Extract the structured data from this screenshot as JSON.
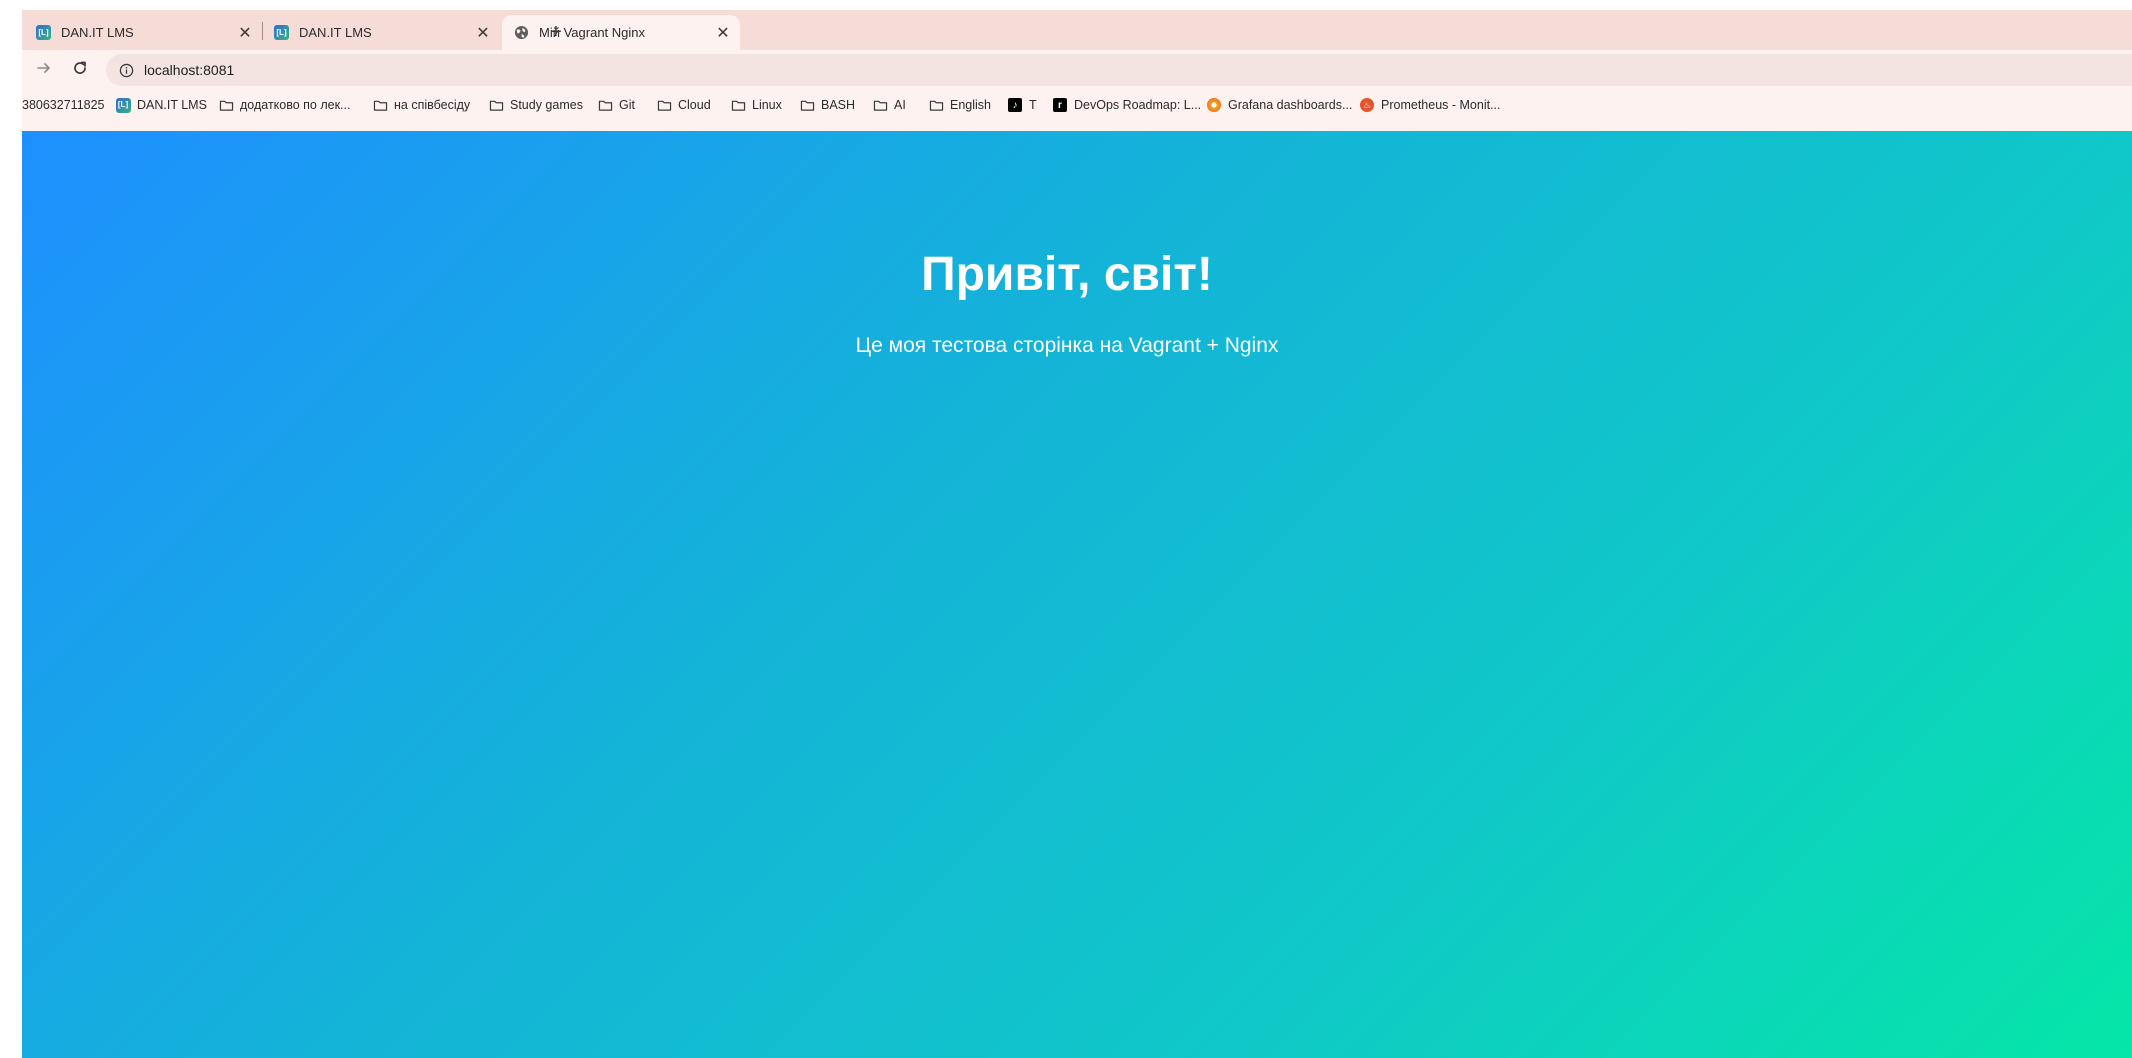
{
  "browser": {
    "tabs": [
      {
        "title": "DAN.IT LMS",
        "icon": "lms-favicon",
        "active": false
      },
      {
        "title": "DAN.IT LMS",
        "icon": "lms-favicon",
        "active": false
      },
      {
        "title": "Мій Vagrant Nginx",
        "icon": "globe-icon",
        "active": true
      }
    ],
    "tab_close_glyph": "✕",
    "new_tab_glyph": "+",
    "address_bar": {
      "url": "localhost:8081"
    },
    "bookmarks": [
      {
        "label": "380632711825",
        "icon": ""
      },
      {
        "label": "DAN.IT LMS",
        "icon": "lms-favicon"
      },
      {
        "label": "додатково по лек...",
        "icon": "folder-icon"
      },
      {
        "label": "на співбесіду",
        "icon": "folder-icon"
      },
      {
        "label": "Study games",
        "icon": "folder-icon"
      },
      {
        "label": "Git",
        "icon": "folder-icon"
      },
      {
        "label": "Cloud",
        "icon": "folder-icon"
      },
      {
        "label": "Linux",
        "icon": "folder-icon"
      },
      {
        "label": "BASH",
        "icon": "folder-icon"
      },
      {
        "label": "AI",
        "icon": "folder-icon"
      },
      {
        "label": "English",
        "icon": "folder-icon"
      },
      {
        "label": "T",
        "icon": "tiktok-icon"
      },
      {
        "label": "DevOps Roadmap: L...",
        "icon": "roadmap-icon"
      },
      {
        "label": "Grafana dashboards...",
        "icon": "grafana-icon"
      },
      {
        "label": "Prometheus - Monit...",
        "icon": "prometheus-icon"
      }
    ]
  },
  "page": {
    "heading": "Привіт, світ!",
    "subheading": "Це моя тестова сторінка на Vagrant + Nginx",
    "gradient_start": "#1e90ff",
    "gradient_end": "#05e6a8"
  }
}
